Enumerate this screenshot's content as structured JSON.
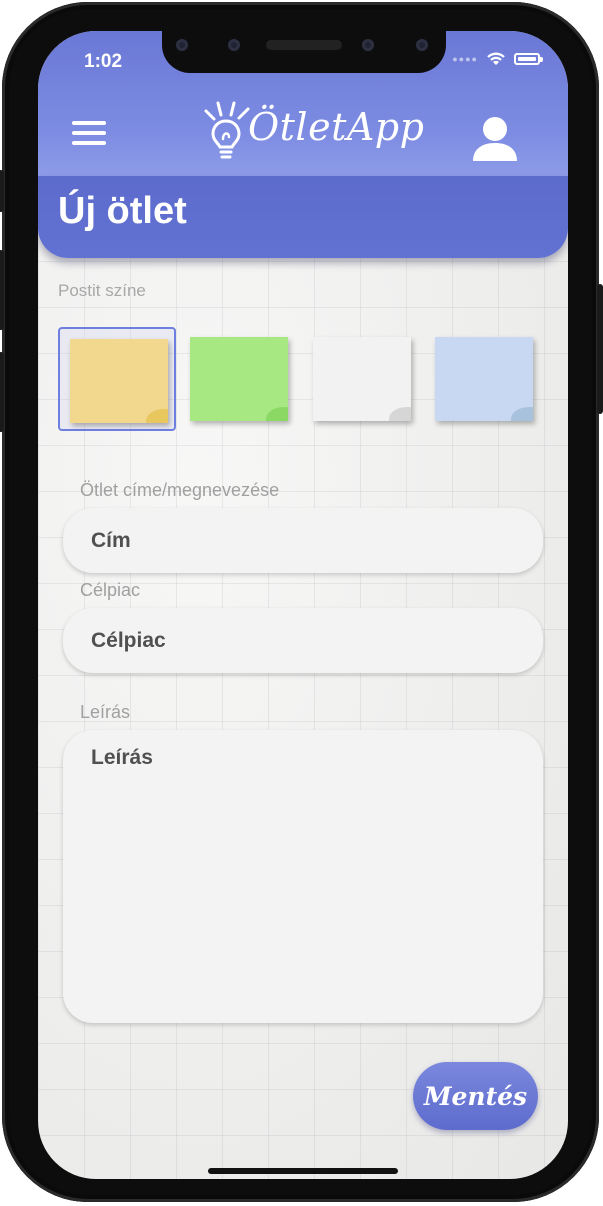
{
  "status_bar": {
    "time": "1:02"
  },
  "app_bar": {
    "logo_text": "ÖtletApp",
    "menu_icon": "hamburger-menu-icon",
    "user_icon": "user-icon",
    "background_color": "#7483dc"
  },
  "page": {
    "title": "Új ötlet"
  },
  "color_picker": {
    "label": "Postit színe",
    "selected_index": 0,
    "options": [
      {
        "name": "yellow",
        "color": "#f2d88f",
        "curl": "#e8c75e"
      },
      {
        "name": "green",
        "color": "#a7e883",
        "curl": "#8bd864"
      },
      {
        "name": "white",
        "color": "#f2f2f2",
        "curl": "#d6d6d6"
      },
      {
        "name": "blue",
        "color": "#c8d8f2",
        "curl": "#a8c2de"
      }
    ]
  },
  "form": {
    "title_label": "Ötlet címe/megnevezése",
    "title_placeholder": "Cím",
    "market_label": "Célpiac",
    "market_placeholder": "Célpiac",
    "description_label": "Leírás",
    "description_placeholder": "Leírás"
  },
  "actions": {
    "save_label": "Mentés",
    "accent_color": "#6675d4"
  }
}
